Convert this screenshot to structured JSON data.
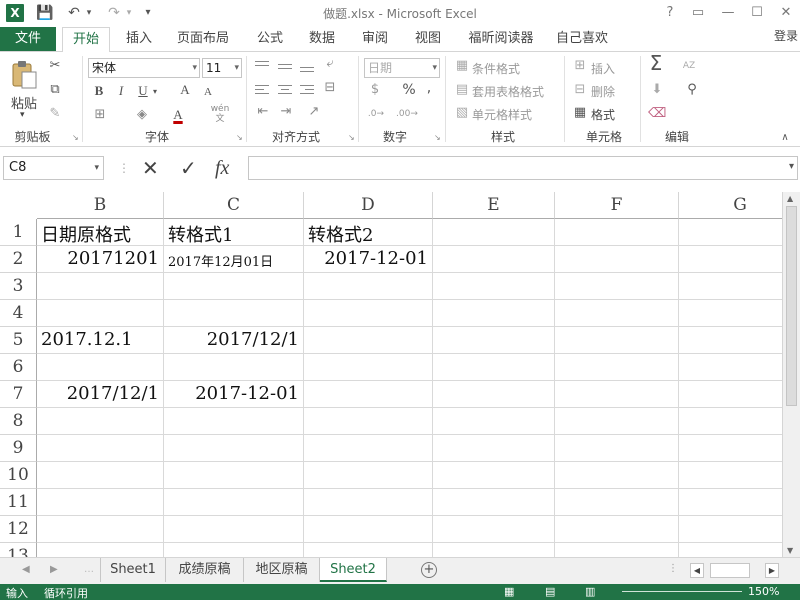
{
  "window": {
    "title": "做题.xlsx - Microsoft Excel",
    "help": "?",
    "restore_ribbon": "▭",
    "minimize": "—",
    "maximize": "☐",
    "close": "✕"
  },
  "qat": {
    "save": "💾",
    "undo": "↶",
    "redo": "↷",
    "customize": "▾"
  },
  "tabs": [
    "文件",
    "开始",
    "插入",
    "页面布局",
    "公式",
    "数据",
    "审阅",
    "视图",
    "福昕阅读器",
    "自己喜欢"
  ],
  "login": "登录",
  "ribbon": {
    "clipboard": {
      "paste": "粘贴",
      "label": "剪贴板"
    },
    "font": {
      "name": "宋体",
      "size": "11",
      "bold": "B",
      "italic": "I",
      "underline": "U",
      "grow": "A",
      "shrink": "A",
      "label": "字体",
      "color_accent": "#c00000",
      "wen": "wén 文"
    },
    "alignment": {
      "label": "对齐方式"
    },
    "number": {
      "format": "日期",
      "percent": "%",
      "comma": ",",
      "label": "数字"
    },
    "styles": {
      "conditional": "条件格式",
      "table": "套用表格格式",
      "cell": "单元格样式",
      "label": "样式"
    },
    "cells": {
      "insert": "插入",
      "delete": "删除",
      "format": "格式",
      "label": "单元格"
    },
    "editing": {
      "sum": "Σ",
      "sort": "AZ",
      "find": "🔍",
      "label": "编辑"
    }
  },
  "formula_bar": {
    "name_box": "C8",
    "cancel": "✕",
    "enter": "✓",
    "fx": "fx",
    "value": ""
  },
  "grid": {
    "columns": [
      "B",
      "C",
      "D",
      "E",
      "F",
      "G"
    ],
    "rows": [
      "1",
      "2",
      "3",
      "4",
      "5",
      "6",
      "7",
      "8",
      "9",
      "10",
      "11",
      "12",
      "13"
    ],
    "cells": {
      "B1": "日期原格式",
      "C1": "转格式1",
      "D1": "转格式2",
      "B2": "20171201",
      "C2": "2017年12月01日",
      "D2": "2017-12-01",
      "B5": "2017.12.1",
      "C5": "2017/12/1",
      "B7": "2017/12/1",
      "C7": "2017-12-01"
    }
  },
  "sheets": {
    "tabs": [
      "Sheet1",
      "成绩原稿",
      "地区原稿",
      "Sheet2"
    ],
    "active": "Sheet2",
    "add": "+"
  },
  "status": {
    "mode": "输入",
    "circular": "循环引用",
    "zoom": "150%"
  },
  "colors": {
    "accent": "#217346"
  }
}
